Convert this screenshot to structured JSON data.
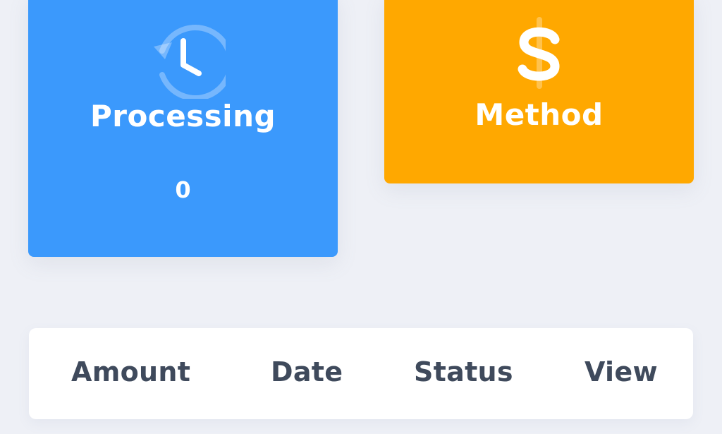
{
  "cards": {
    "processing": {
      "title": "Processing",
      "count": "0",
      "icon": "history-clock-icon",
      "color": "#3b99fc"
    },
    "method": {
      "title": "Method",
      "icon": "dollar-icon",
      "color": "#ffa800"
    }
  },
  "table": {
    "columns": [
      "Amount",
      "Date",
      "Status",
      "View"
    ]
  }
}
